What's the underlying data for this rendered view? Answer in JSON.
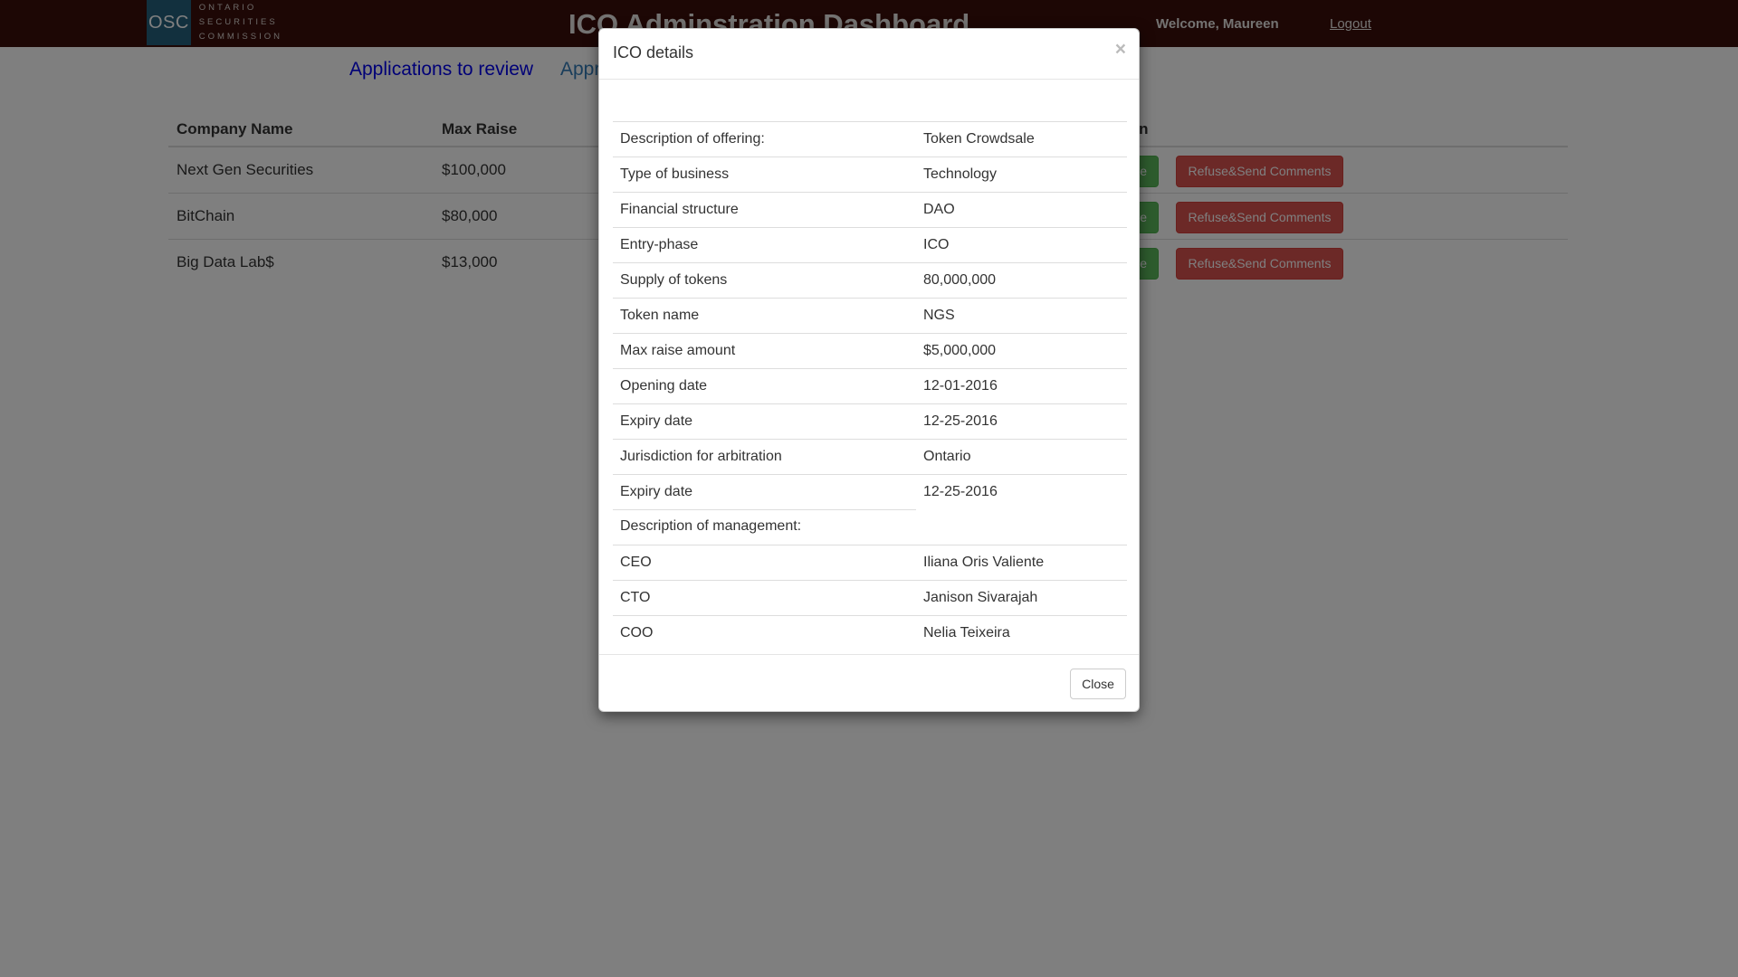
{
  "header": {
    "logo_abbrev": "OSC",
    "logo_line1": "ONTARIO",
    "logo_line2": "SECURITIES",
    "logo_line3": "COMMISSION",
    "title": "ICO Adminstration Dashboard",
    "welcome": "Welcome, Maureen",
    "logout": "Logout"
  },
  "tabs": [
    {
      "label": "Applications to review"
    },
    {
      "label": "Appr"
    }
  ],
  "table": {
    "columns": [
      "Company Name",
      "Max Raise",
      "ion"
    ],
    "rows": [
      {
        "company": "Next Gen Securities",
        "max_raise": "$100,000",
        "approve": "ove",
        "refuse": "Refuse&Send Comments"
      },
      {
        "company": "BitChain",
        "max_raise": "$80,000",
        "approve": "ove",
        "refuse": "Refuse&Send Comments"
      },
      {
        "company": "Big Data Lab$",
        "max_raise": "$13,000",
        "approve": "ove",
        "refuse": "Refuse&Send Comments"
      }
    ]
  },
  "modal": {
    "title": "ICO details",
    "close_x": "×",
    "rows": [
      {
        "label": "Description of offering:",
        "value": "Token Crowdsale"
      },
      {
        "label": "Type of business",
        "value": "Technology"
      },
      {
        "label": "Financial structure",
        "value": "DAO"
      },
      {
        "label": "Entry-phase",
        "value": "ICO"
      },
      {
        "label": "Supply of tokens",
        "value": "80,000,000"
      },
      {
        "label": "Token name",
        "value": "NGS"
      },
      {
        "label": "Max raise amount",
        "value": "$5,000,000"
      },
      {
        "label": "Opening date",
        "value": "12-01-2016"
      },
      {
        "label": "Expiry date",
        "value": "12-25-2016"
      },
      {
        "label": "Jurisdiction for arbitration",
        "value": "Ontario"
      },
      {
        "label": "Expiry date",
        "value": "12-25-2016"
      },
      {
        "label": "Description of management:",
        "value": ""
      },
      {
        "label": "CEO",
        "value": "Iliana Oris Valiente"
      },
      {
        "label": "CTO",
        "value": "Janison Sivarajah"
      },
      {
        "label": "COO",
        "value": "Nelia Teixeira"
      }
    ],
    "close_button": "Close"
  }
}
